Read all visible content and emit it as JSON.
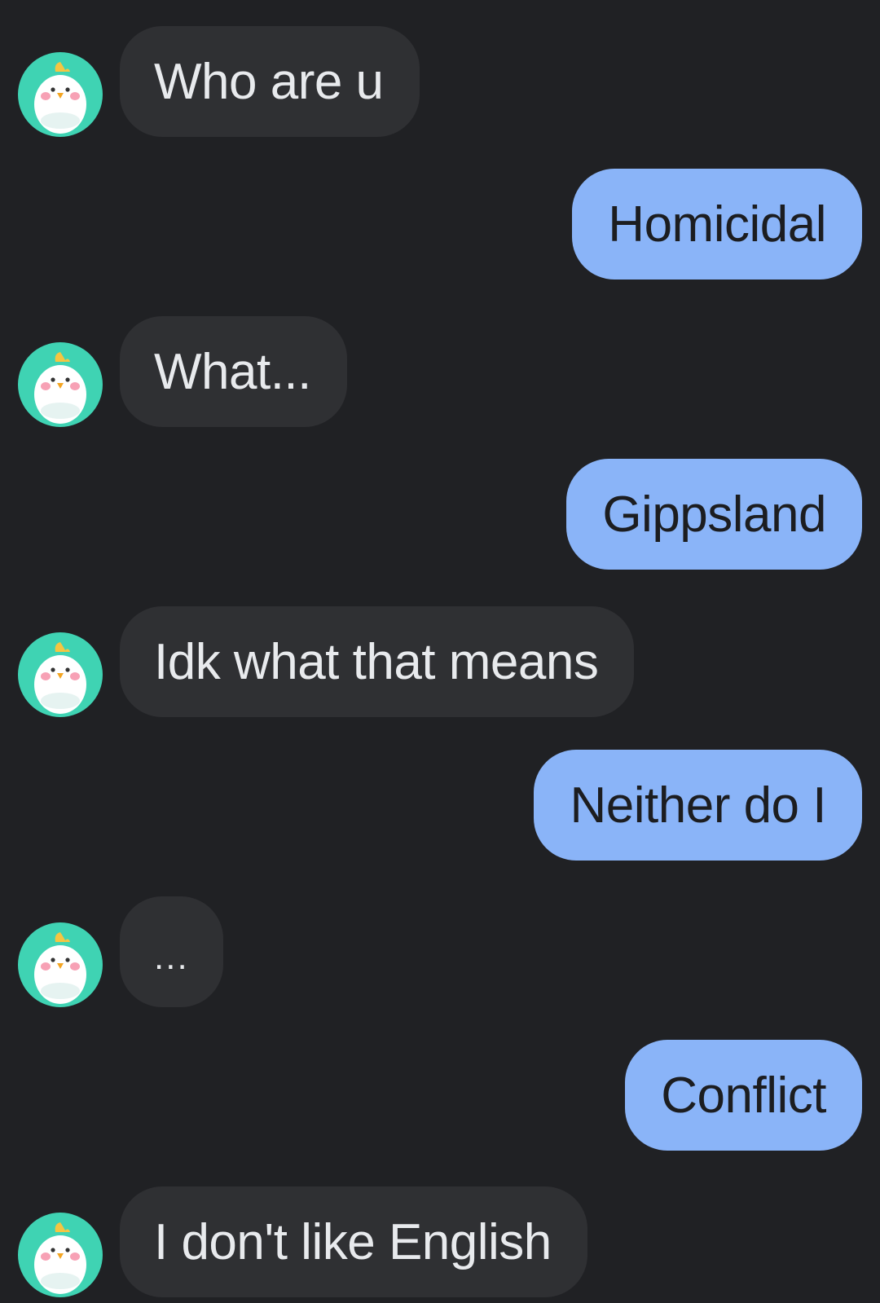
{
  "messages": [
    {
      "sender": "bot",
      "text": "Who are u"
    },
    {
      "sender": "user",
      "text": "Homicidal"
    },
    {
      "sender": "bot",
      "text": "What..."
    },
    {
      "sender": "user",
      "text": "Gippsland"
    },
    {
      "sender": "bot",
      "text": "Idk what that means"
    },
    {
      "sender": "user",
      "text": "Neither do I"
    },
    {
      "sender": "bot",
      "text": "..."
    },
    {
      "sender": "user",
      "text": "Conflict"
    },
    {
      "sender": "bot",
      "text": "I don't like English"
    }
  ],
  "avatar_icon": "chicken-avatar-icon",
  "colors": {
    "background": "#202124",
    "incoming_bubble": "#2f3033",
    "outgoing_bubble": "#8ab4f8",
    "avatar_background": "#3fd3b3"
  }
}
